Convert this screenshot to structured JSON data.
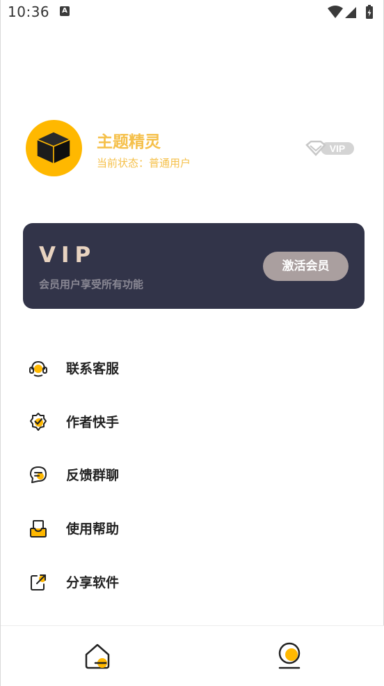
{
  "status_bar": {
    "time": "10:36",
    "notification_glyph": "A",
    "icons": [
      "wifi-icon",
      "signal-icon",
      "battery-charging-icon"
    ]
  },
  "profile": {
    "name": "主题精灵",
    "status": "当前状态：普通用户",
    "avatar_icon": "cube-icon",
    "badge_text": "VIP"
  },
  "vip_card": {
    "title": "VIP",
    "description": "会员用户享受所有功能",
    "activate_label": "激活会员"
  },
  "menu": {
    "items": [
      {
        "label": "联系客服",
        "icon": "customer-service-icon"
      },
      {
        "label": "作者快手",
        "icon": "verified-badge-icon"
      },
      {
        "label": "反馈群聊",
        "icon": "chat-bubble-icon"
      },
      {
        "label": "使用帮助",
        "icon": "inbox-help-icon"
      },
      {
        "label": "分享软件",
        "icon": "share-icon"
      }
    ]
  },
  "bottom_nav": {
    "items": [
      {
        "name": "home",
        "icon": "home-icon"
      },
      {
        "name": "mine",
        "icon": "profile-icon",
        "active": true
      }
    ]
  },
  "colors": {
    "accent": "#ffb800",
    "name_text": "#f5c04a",
    "card_bg": "#323449",
    "vip_title": "#e8d3c0",
    "activate_button": "#aa9f9f"
  }
}
